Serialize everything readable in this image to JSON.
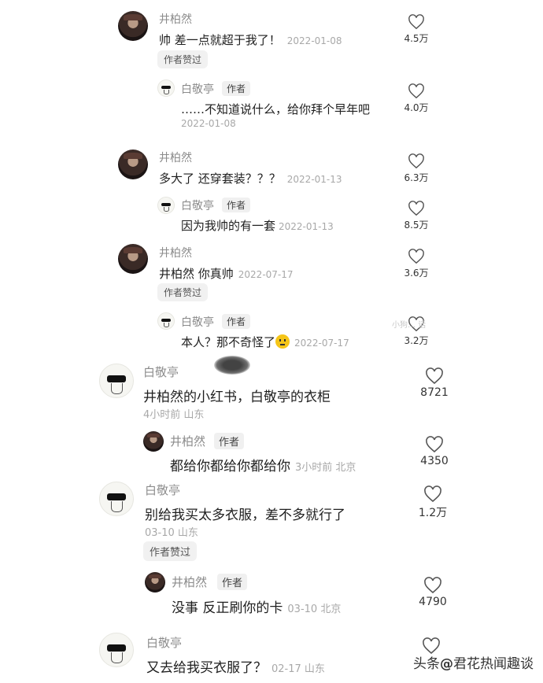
{
  "comments": [
    {
      "name": "井柏然",
      "text": "帅 差一点就超于我了！",
      "date": "2022-01-08",
      "liked": "作者赞过",
      "likes": "4.5万"
    },
    {
      "name": "白敬亭",
      "tag": "作者",
      "text": "……不知道说什么，给你拜个早年吧",
      "date": "2022-01-08",
      "likes": "4.0万"
    },
    {
      "name": "井柏然",
      "text": "多大了 还穿套装？？？",
      "date": "2022-01-13",
      "likes": "6.3万"
    },
    {
      "name": "白敬亭",
      "tag": "作者",
      "text": "因为我帅的有一套",
      "date": "2022-01-13",
      "likes": "8.5万"
    },
    {
      "name": "井柏然",
      "text": "井柏然 你真帅",
      "date": "2022-07-17",
      "liked": "作者赞过",
      "likes": "3.6万"
    },
    {
      "name": "白敬亭",
      "tag": "作者",
      "text": "本人？那不奇怪了",
      "date": "2022-07-17",
      "likes": "3.2万"
    },
    {
      "name": "白敬亭",
      "text": "井柏然的小红书，白敬亭的衣柜",
      "date": "4小时前 山东",
      "likes": "8721"
    },
    {
      "name": "井柏然",
      "tag": "作者",
      "text": "都给你都给你都给你",
      "date": "3小时前 北京",
      "likes": "4350"
    },
    {
      "name": "白敬亭",
      "text": "别给我买太多衣服，差不多就行了",
      "date": "03-10 山东",
      "liked": "作者赞过",
      "likes": "1.2万"
    },
    {
      "name": "井柏然",
      "tag": "作者",
      "text": "没事 反正刷你的卡",
      "date": "03-10 北京",
      "likes": "4790"
    },
    {
      "name": "白敬亭",
      "text": "又去给我买衣服了？",
      "date": "02-17 山东",
      "likes": ""
    }
  ],
  "icons": {
    "like": "heart-outline-icon",
    "emoji": "face-emoji-icon"
  },
  "faint_text": "小狗…  话",
  "watermark": {
    "prefix": "头条",
    "at": "@",
    "account": "君花热闻趣谈"
  }
}
